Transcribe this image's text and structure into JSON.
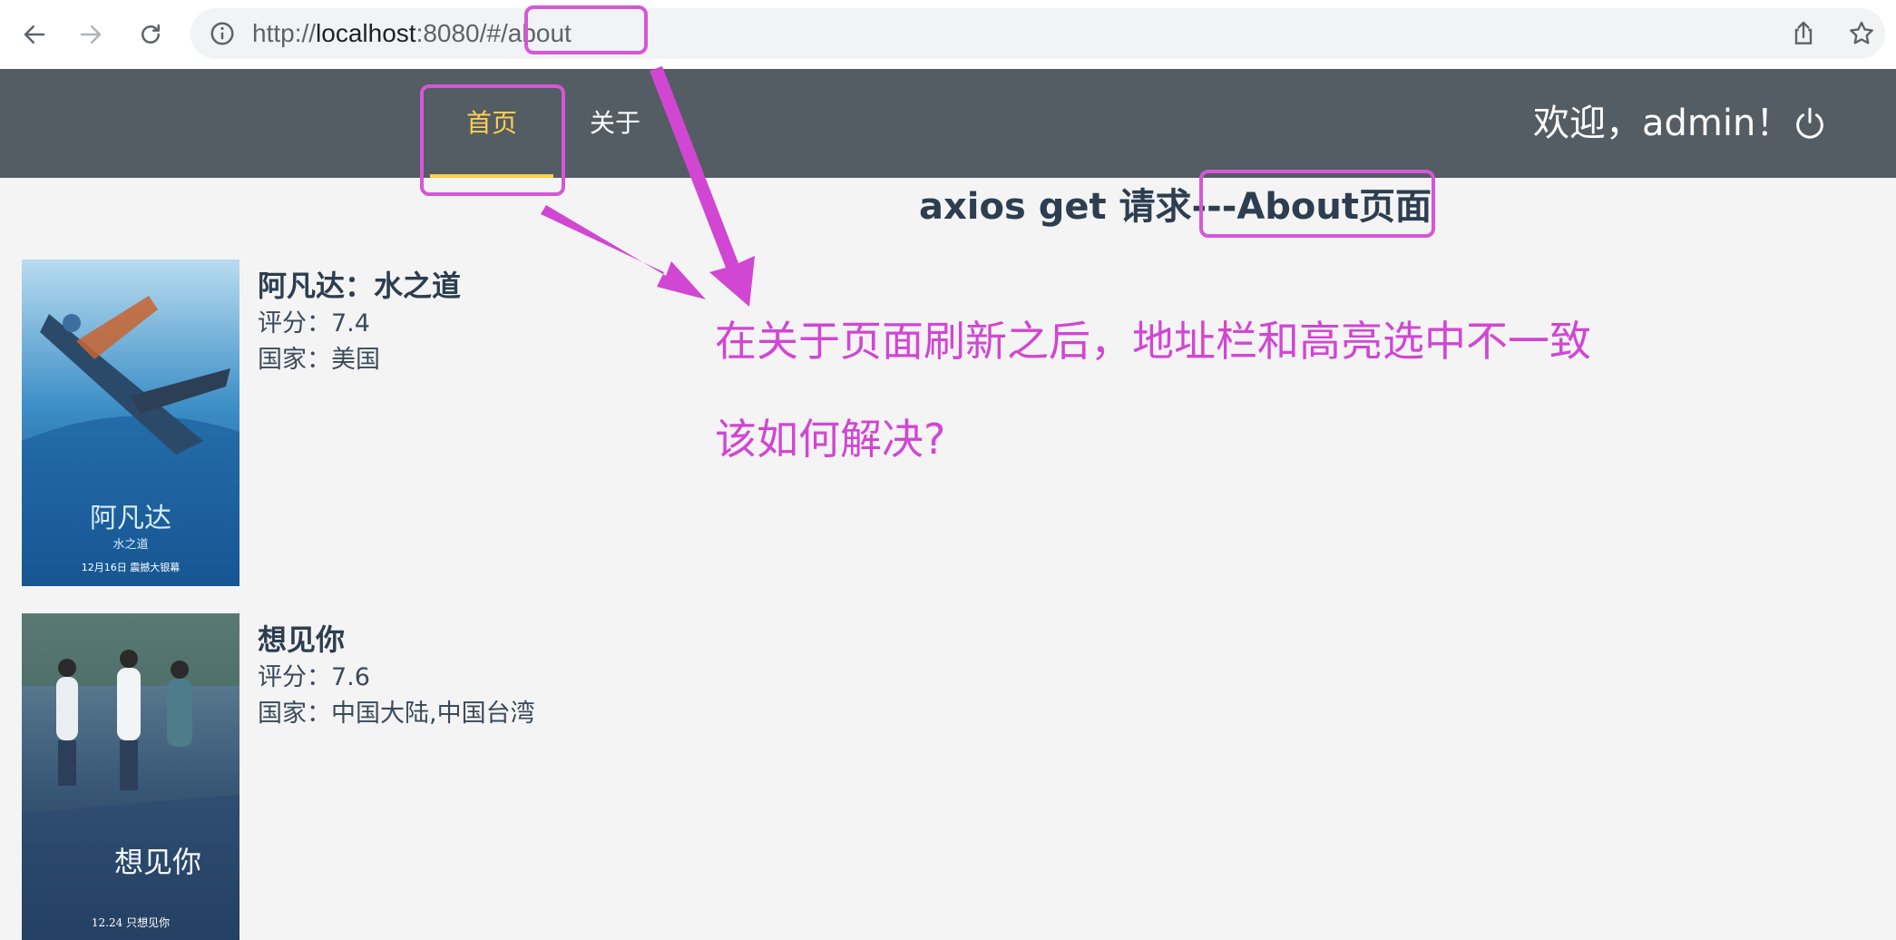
{
  "browser": {
    "url_prefix": "http://",
    "url_host": "localhost",
    "url_rest": ":8080/#/about",
    "back_icon": "back-arrow-icon",
    "forward_icon": "forward-arrow-icon",
    "reload_icon": "reload-icon",
    "info_icon": "info-icon",
    "share_icon": "share-icon",
    "bookmark_icon": "star-icon"
  },
  "header": {
    "menu": [
      {
        "label": "首页",
        "active": true
      },
      {
        "label": "关于",
        "active": false
      }
    ],
    "welcome": "欢迎，admin！",
    "logout_icon": "power-icon",
    "background": "#545c64",
    "active_color": "#ffd04b"
  },
  "main": {
    "heading": "axios get 请求---About页面",
    "movies": [
      {
        "title": "阿凡达：水之道",
        "rating": "评分：7.4",
        "country": "国家：美国",
        "poster_text": "阿凡达",
        "poster_sub": "水之道",
        "poster_date": "12月16日 震撼大银幕"
      },
      {
        "title": "想见你",
        "rating": "评分：7.6",
        "country": "国家：中国大陆,中国台湾",
        "poster_text": "想见你",
        "poster_sub": "",
        "poster_date": "12.24 只想见你"
      }
    ]
  },
  "annotation": {
    "line1": "在关于页面刷新之后，地址栏和高亮选中不一致",
    "line2": "该如何解决?",
    "color": "#d557d6"
  }
}
